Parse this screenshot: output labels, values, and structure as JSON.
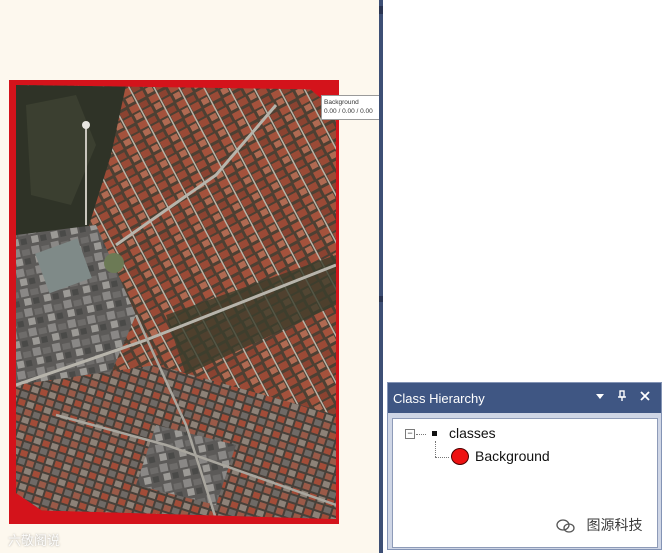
{
  "viewer": {
    "tooltip": {
      "class_name": "Background",
      "values": "0.00 / 0.00 / 0.00"
    },
    "frame_color": "#d4131b"
  },
  "class_hierarchy_panel": {
    "title": "Class Hierarchy",
    "buttons": [
      "dropdown-arrow-icon",
      "pin-icon",
      "close-icon"
    ],
    "tree": {
      "root": {
        "expander": "⊟",
        "label": "classes",
        "children": [
          {
            "label": "Background",
            "color": "#ee1111"
          }
        ]
      }
    }
  },
  "watermarks": {
    "left": "六敬阁说",
    "right": "图源科技"
  }
}
